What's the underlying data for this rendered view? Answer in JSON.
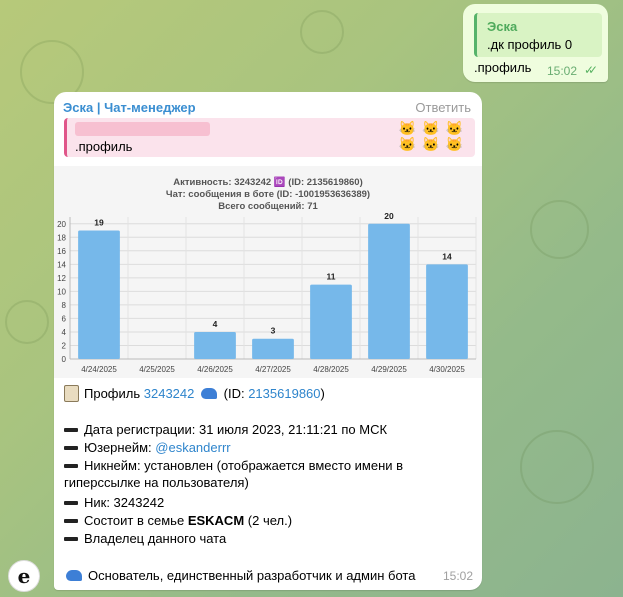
{
  "outgoing": {
    "quote_name": "Эска",
    "quote_text": ".дк профиль 0",
    "text": ".профиль",
    "time": "15:02",
    "status": "read"
  },
  "incoming": {
    "sender": "Эска | Чат-менеджер",
    "reply_label": "Ответить",
    "reply_quote_text": ".профиль",
    "time": "15:02"
  },
  "chart_data": {
    "type": "bar",
    "title_lines": [
      "Активность: 3243242 🆔 (ID: 2135619860)",
      "Чат: сообщения в боте (ID: -1001953636389)",
      "Всего сообщений: 71"
    ],
    "categories": [
      "4/24/2025",
      "4/25/2025",
      "4/26/2025",
      "4/27/2025",
      "4/28/2025",
      "4/29/2025",
      "4/30/2025"
    ],
    "values": [
      19,
      0,
      4,
      3,
      11,
      20,
      14
    ],
    "data_labels": [
      "19",
      "",
      "4",
      "3",
      "11",
      "20",
      "14"
    ],
    "yticks": [
      "0",
      "2",
      "4",
      "6",
      "8",
      "10",
      "12",
      "14",
      "16",
      "18",
      "20"
    ],
    "ylim": [
      0,
      21
    ],
    "grid": true,
    "bar_color": "#76b8ea"
  },
  "profile": {
    "header_prefix": "Профиль",
    "header_nick": "3243242",
    "header_id_open": "(ID:",
    "header_id": "2135619860",
    "header_id_close": ")",
    "reg_date": "Дата регистрации: 31 июля 2023, 21:11:21 по МСК",
    "username_label": "Юзернейм:",
    "username": "@eskanderrr",
    "nickname_line1": "Никнейм: установлен (отображается вместо имени в",
    "nickname_line2": "гиперссылке на пользователя)",
    "nick": "Ник: 3243242",
    "family_prefix": "Состоит в семье",
    "family_name": "ESKACM",
    "family_suffix": "(2 чел.)",
    "owner": "Владелец данного чата",
    "founder": "Основатель, единственный разработчик и админ бота"
  },
  "avatar": {
    "letter": "e"
  }
}
